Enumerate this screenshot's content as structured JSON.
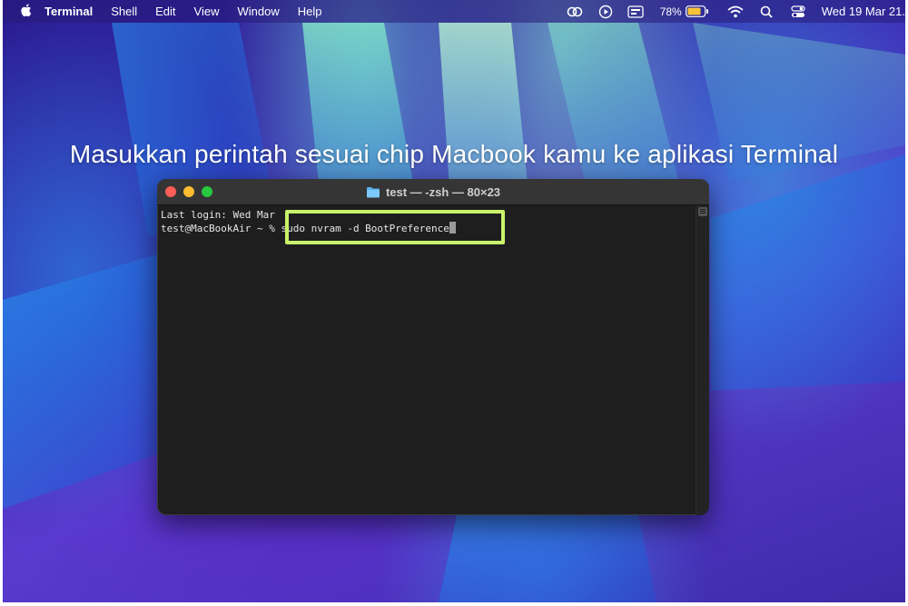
{
  "menubar": {
    "app_name": "Terminal",
    "menus": [
      "Shell",
      "Edit",
      "View",
      "Window",
      "Help"
    ],
    "battery_percent": "78%",
    "clock": "Wed 19 Mar 21."
  },
  "caption": "Masukkan perintah sesuai chip Macbook kamu ke aplikasi Terminal",
  "terminal": {
    "title": "test — -zsh — 80×23",
    "last_login": "Last login: Wed Mar",
    "prompt": "test@MacBookAir ~ %",
    "command": "sudo nvram -d BootPreference"
  },
  "colors": {
    "highlight": "#c9f26a",
    "terminal_bg": "#1e1e1e"
  }
}
